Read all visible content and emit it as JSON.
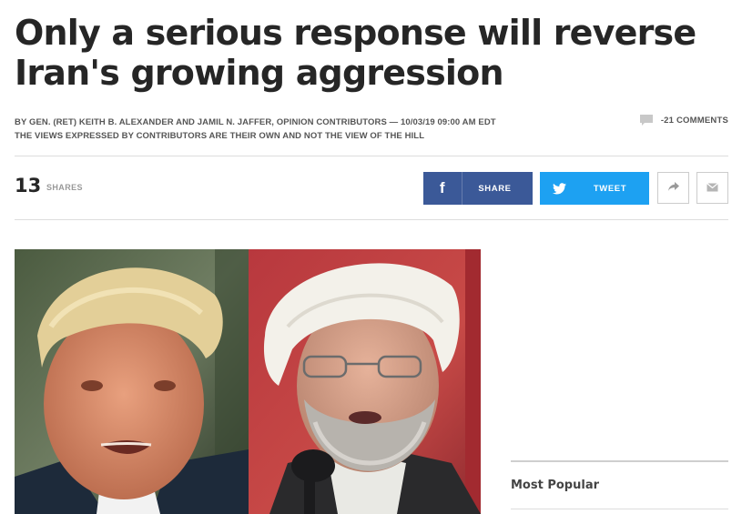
{
  "article": {
    "headline": "Only a serious response will reverse Iran's growing aggression",
    "byline": "BY GEN. (RET) KEITH B. ALEXANDER AND JAMIL N. JAFFER, OPINION CONTRIBUTORS — 10/03/19 09:00 AM EDT",
    "disclaimer": "THE VIEWS EXPRESSED BY CONTRIBUTORS ARE THEIR OWN AND NOT THE VIEW OF THE HILL",
    "comments_label": "-21 COMMENTS",
    "comments_icon": "speech-bubble-icon"
  },
  "share_bar": {
    "count": "13",
    "count_label": "SHARES",
    "facebook": {
      "label": "SHARE",
      "icon": "facebook-icon",
      "color": "#3b5998"
    },
    "twitter": {
      "label": "TWEET",
      "icon": "twitter-bird-icon",
      "color": "#1da1f2"
    },
    "more_icon": "share-arrow-icon",
    "email_icon": "envelope-icon"
  },
  "sidebar": {
    "most_popular_title": "Most Popular"
  }
}
